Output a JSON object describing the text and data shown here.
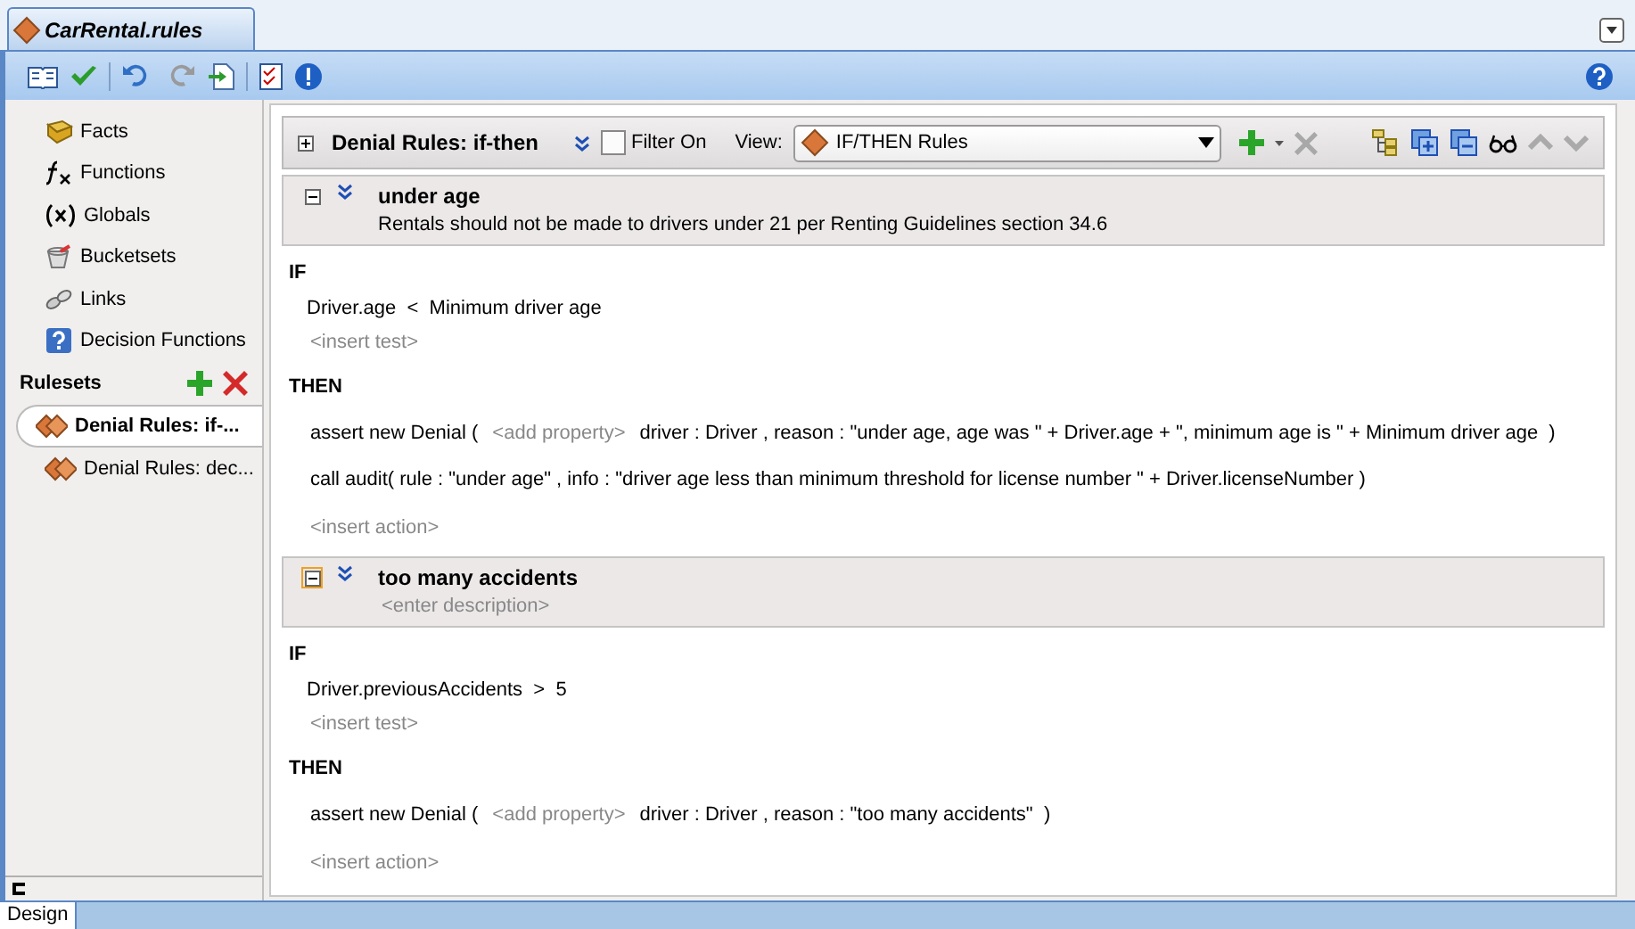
{
  "editor_tab": {
    "title": "CarRental.rules",
    "selected": true
  },
  "sidebar": {
    "items": [
      {
        "label": "Facts"
      },
      {
        "label": "Functions"
      },
      {
        "label": "Globals"
      },
      {
        "label": "Bucketsets"
      },
      {
        "label": "Links"
      },
      {
        "label": "Decision Functions"
      }
    ],
    "rulesets_label": "Rulesets",
    "rulesets": [
      {
        "label": "Denial Rules: if-...",
        "selected": true
      },
      {
        "label": "Denial Rules: dec...",
        "selected": false
      }
    ]
  },
  "ruleset_header": {
    "title": "Denial Rules: if-then",
    "filter_label": "Filter On",
    "filter_on": false,
    "view_label": "View:",
    "view_value": "IF/THEN Rules"
  },
  "rules": [
    {
      "name": "under age",
      "description": "Rentals should not be made to drivers under 21 per Renting Guidelines section 34.6",
      "description_is_placeholder": false,
      "toggle_focused": false,
      "if_label": "IF",
      "tests": [
        "Driver.age  <  Minimum driver age"
      ],
      "insert_test": "<insert test>",
      "then_label": "THEN",
      "actions": [
        [
          {
            "kind": "code",
            "text": "assert new Denial ("
          },
          {
            "kind": "hint",
            "text": "<add property>"
          },
          {
            "kind": "code",
            "text": "driver : Driver , reason : \"under age, age was \" + Driver.age + \", minimum age is \" + Minimum driver age  )"
          }
        ],
        [
          {
            "kind": "code",
            "text": "call audit( rule : \"under age\" , info : \"driver age less than minimum threshold for license number \" + Driver.licenseNumber )"
          }
        ]
      ],
      "insert_action": "<insert action>"
    },
    {
      "name": "too many accidents",
      "description": "<enter description>",
      "description_is_placeholder": true,
      "toggle_focused": true,
      "if_label": "IF",
      "tests": [
        "Driver.previousAccidents  >  5"
      ],
      "insert_test": "<insert test>",
      "then_label": "THEN",
      "actions": [
        [
          {
            "kind": "code",
            "text": "assert new Denial ("
          },
          {
            "kind": "hint",
            "text": "<add property>"
          },
          {
            "kind": "code",
            "text": "driver : Driver , reason : \"too many accidents\"  )"
          }
        ]
      ],
      "insert_action": "<insert action>"
    }
  ],
  "bottom_tabs": [
    {
      "label": "Design",
      "selected": true
    }
  ]
}
